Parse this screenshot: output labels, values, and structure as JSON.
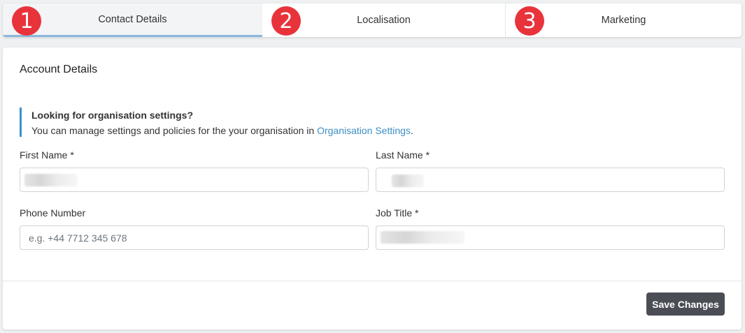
{
  "tabs": [
    {
      "step": "1",
      "label": "Contact Details",
      "active": true
    },
    {
      "step": "2",
      "label": "Localisation",
      "active": false
    },
    {
      "step": "3",
      "label": "Marketing",
      "active": false
    }
  ],
  "card": {
    "title": "Account Details",
    "callout": {
      "title": "Looking for organisation settings?",
      "body_prefix": "You can manage settings and policies for the your organisation in ",
      "link": "Organisation Settings",
      "body_suffix": "."
    },
    "fields": {
      "first_name": {
        "label": "First Name *",
        "value": ""
      },
      "last_name": {
        "label": "Last Name *",
        "value": ""
      },
      "phone": {
        "label": "Phone Number",
        "value": "",
        "placeholder": "e.g. +44 7712 345 678"
      },
      "job_title": {
        "label": "Job Title *",
        "value": ""
      }
    },
    "save_label": "Save Changes"
  },
  "colors": {
    "step_badge": "#e8333b",
    "active_tab_underline": "#8bb8dc",
    "callout_border": "#3b8fd0",
    "link": "#3d8fc6",
    "save_button": "#4a4e54"
  }
}
